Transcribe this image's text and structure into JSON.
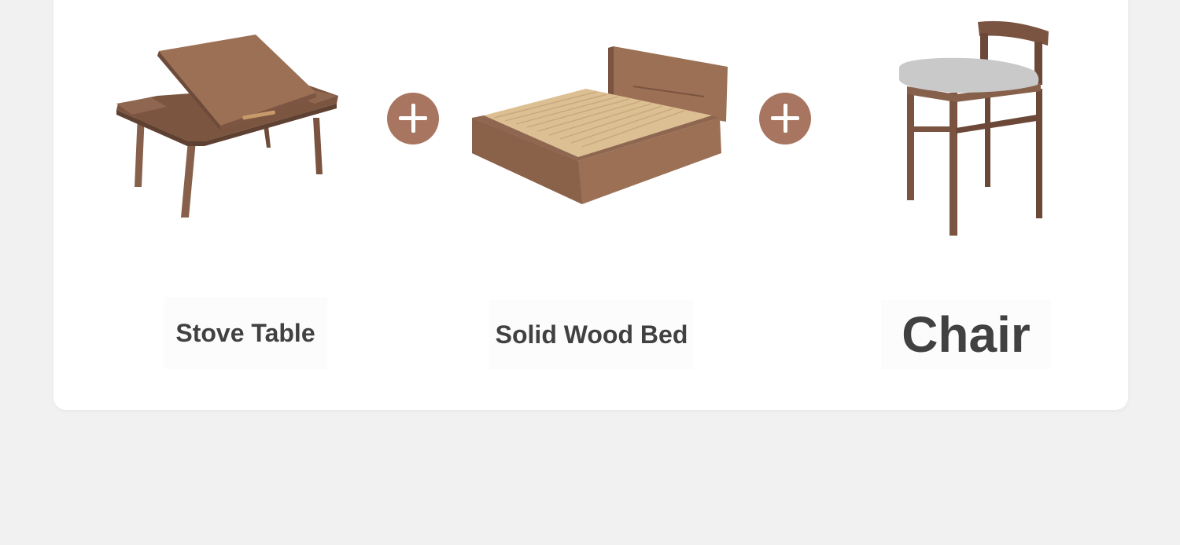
{
  "colors": {
    "page_background": "#f1f1f1",
    "card_background": "#ffffff",
    "plus_button": "#a87560",
    "label_text": "#414141",
    "wood_dark": "#7a5440",
    "wood_mid": "#9b7055",
    "wood_light": "#d8b98e",
    "cushion_gray": "#c9c9c9"
  },
  "products": [
    {
      "name": "Stove Table",
      "icon": "stove-table-image"
    },
    {
      "name": "Solid Wood Bed",
      "icon": "bed-image"
    },
    {
      "name": "Chair",
      "icon": "chair-image"
    }
  ],
  "connectors": [
    {
      "icon": "plus-icon"
    },
    {
      "icon": "plus-icon"
    }
  ]
}
